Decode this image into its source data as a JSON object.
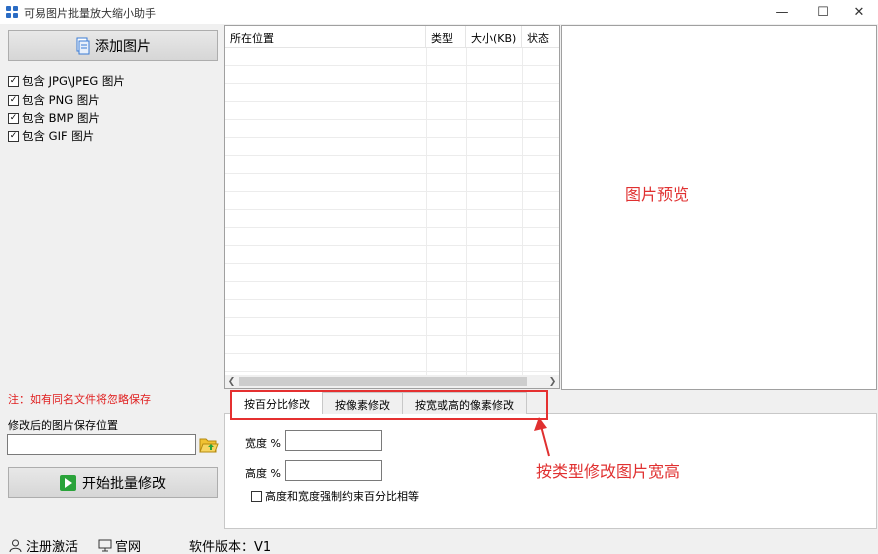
{
  "window": {
    "title": "可易图片批量放大缩小助手",
    "minimize": "—",
    "maximize": "☐",
    "close": "✕"
  },
  "sidebar": {
    "add_button": "添加图片",
    "checkboxes": [
      {
        "label": "包含 JPG\\JPEG 图片",
        "checked": true
      },
      {
        "label": "包含 PNG 图片",
        "checked": true
      },
      {
        "label": "包含 BMP 图片",
        "checked": true
      },
      {
        "label": "包含 GIF 图片",
        "checked": true
      }
    ],
    "note": "注：如有同名文件将忽略保存",
    "save_label": "修改后的图片保存位置",
    "save_path": "",
    "start_button": "开始批量修改"
  },
  "file_list": {
    "columns": [
      "所在位置",
      "类型",
      "大小(KB)",
      "状态"
    ]
  },
  "preview": {
    "label": "图片预览"
  },
  "tabs": [
    {
      "label": "按百分比修改",
      "active": true
    },
    {
      "label": "按像素修改",
      "active": false
    },
    {
      "label": "按宽或高的像素修改",
      "active": false
    }
  ],
  "percent_form": {
    "width_label": "宽度 %",
    "width_value": "",
    "height_label": "高度 %",
    "height_value": "",
    "lock_label": "高度和宽度强制约束百分比相等",
    "lock_checked": false
  },
  "annotation": "按类型修改图片宽高",
  "status_bar": {
    "register": "注册激活",
    "website": "官网",
    "version": "软件版本：V1"
  },
  "colors": {
    "accent_red": "#e03030",
    "app_blue": "#2b6cc4",
    "start_green": "#2aa33a"
  }
}
